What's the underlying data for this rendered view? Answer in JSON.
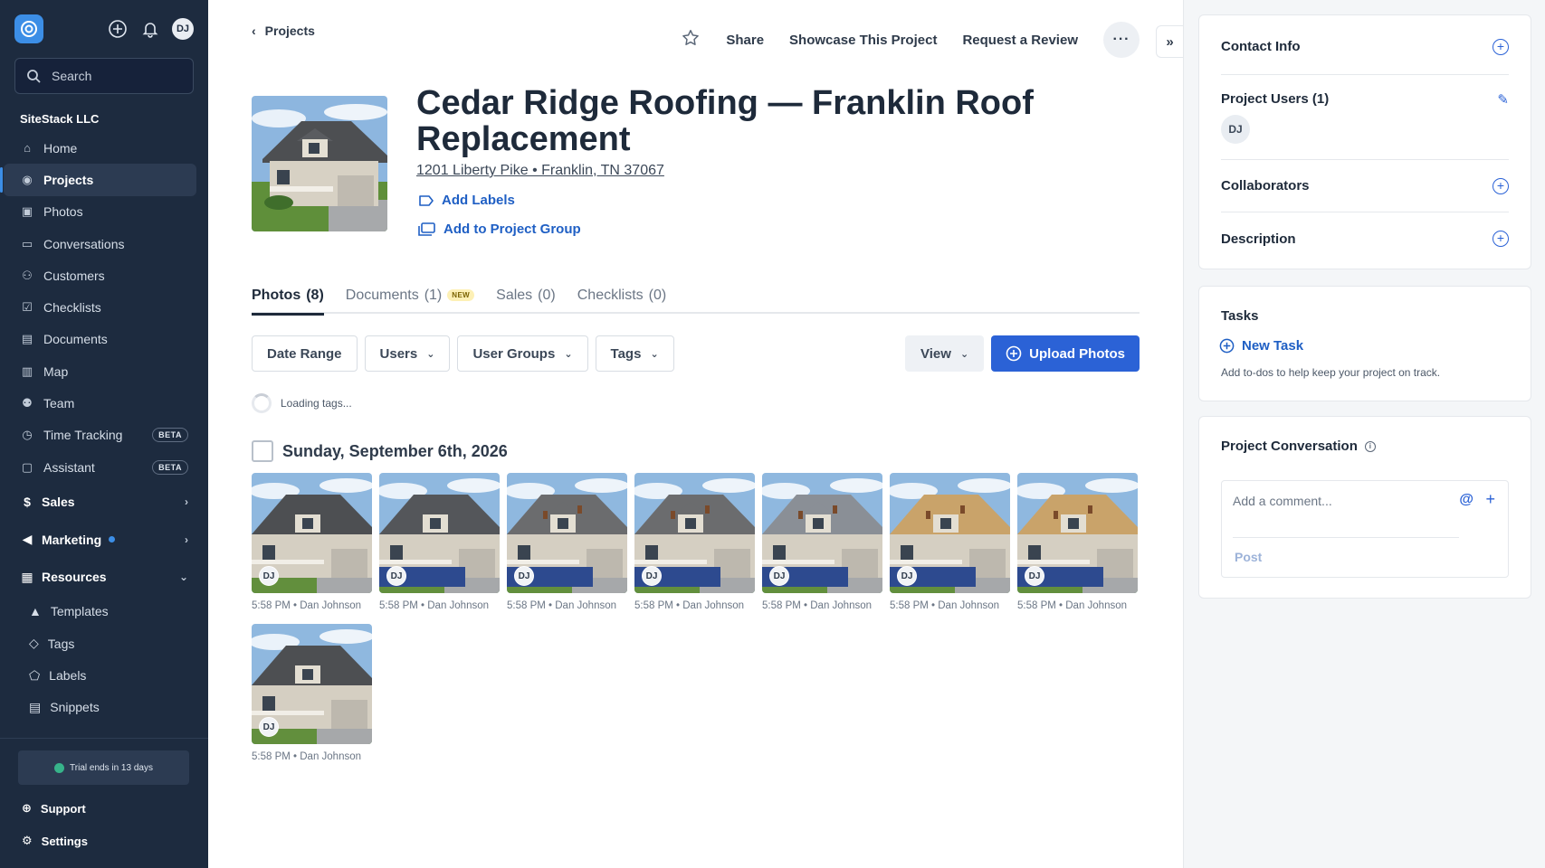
{
  "sidebar": {
    "avatar_initials": "DJ",
    "search_placeholder": "Search",
    "org_name": "SiteStack LLC",
    "items": [
      {
        "label": "Home",
        "icon": "home-icon"
      },
      {
        "label": "Projects",
        "icon": "map-pin-icon"
      },
      {
        "label": "Photos",
        "icon": "photos-icon"
      },
      {
        "label": "Conversations",
        "icon": "chat-icon"
      },
      {
        "label": "Customers",
        "icon": "users-icon"
      },
      {
        "label": "Checklists",
        "icon": "checklist-icon"
      },
      {
        "label": "Documents",
        "icon": "document-icon"
      },
      {
        "label": "Map",
        "icon": "map-icon"
      },
      {
        "label": "Team",
        "icon": "team-icon"
      },
      {
        "label": "Time Tracking",
        "icon": "clock-icon",
        "badge": "BETA"
      },
      {
        "label": "Assistant",
        "icon": "assistant-icon",
        "badge": "BETA"
      }
    ],
    "sections": {
      "sales": "Sales",
      "marketing": "Marketing",
      "resources": "Resources"
    },
    "resources_items": [
      {
        "label": "Templates",
        "icon": "template-icon"
      },
      {
        "label": "Tags",
        "icon": "tag-icon"
      },
      {
        "label": "Labels",
        "icon": "label-icon"
      },
      {
        "label": "Snippets",
        "icon": "snippet-icon"
      }
    ],
    "trial_text": "Trial ends in 13 days",
    "support_label": "Support",
    "settings_label": "Settings"
  },
  "header": {
    "back_label": "Projects",
    "share_label": "Share",
    "showcase_label": "Showcase This Project",
    "review_label": "Request a Review",
    "more_label": "···"
  },
  "project": {
    "title": "Cedar Ridge Roofing — Franklin Roof Replacement",
    "address": "1201 Liberty Pike • Franklin, TN 37067",
    "add_labels": "Add Labels",
    "add_group": "Add to Project Group"
  },
  "tabs": [
    {
      "label": "Photos",
      "count": "(8)"
    },
    {
      "label": "Documents",
      "count": "(1)",
      "badge": "NEW"
    },
    {
      "label": "Sales",
      "count": "(0)"
    },
    {
      "label": "Checklists",
      "count": "(0)"
    }
  ],
  "filters": {
    "date_range": "Date Range",
    "users": "Users",
    "user_groups": "User Groups",
    "tags": "Tags",
    "view": "View",
    "upload": "Upload Photos"
  },
  "loading_text": "Loading tags...",
  "photo_group": {
    "date": "Sunday, September 6th, 2026",
    "photos": [
      {
        "initials": "DJ",
        "caption": "5:58 PM • Dan Johnson",
        "stage": "original"
      },
      {
        "initials": "DJ",
        "caption": "5:58 PM • Dan Johnson",
        "stage": "tarp"
      },
      {
        "initials": "DJ",
        "caption": "5:58 PM • Dan Johnson",
        "stage": "tearoff"
      },
      {
        "initials": "DJ",
        "caption": "5:58 PM • Dan Johnson",
        "stage": "tearoff"
      },
      {
        "initials": "DJ",
        "caption": "5:58 PM • Dan Johnson",
        "stage": "underlay"
      },
      {
        "initials": "DJ",
        "caption": "5:58 PM • Dan Johnson",
        "stage": "decking"
      },
      {
        "initials": "DJ",
        "caption": "5:58 PM • Dan Johnson",
        "stage": "decking"
      },
      {
        "initials": "DJ",
        "caption": "5:58 PM • Dan Johnson",
        "stage": "original"
      }
    ]
  },
  "right_panel": {
    "contact_info": "Contact Info",
    "project_users": "Project Users (1)",
    "user_initials": "DJ",
    "collaborators": "Collaborators",
    "description": "Description",
    "tasks_title": "Tasks",
    "new_task": "New Task",
    "tasks_hint": "Add to-dos to help keep your project on track.",
    "conversation_title": "Project Conversation",
    "comment_placeholder": "Add a comment...",
    "post_label": "Post"
  },
  "colors": {
    "sidebar_bg": "#1d2b3f",
    "accent": "#2b62d6",
    "link": "#1f5fc4"
  }
}
